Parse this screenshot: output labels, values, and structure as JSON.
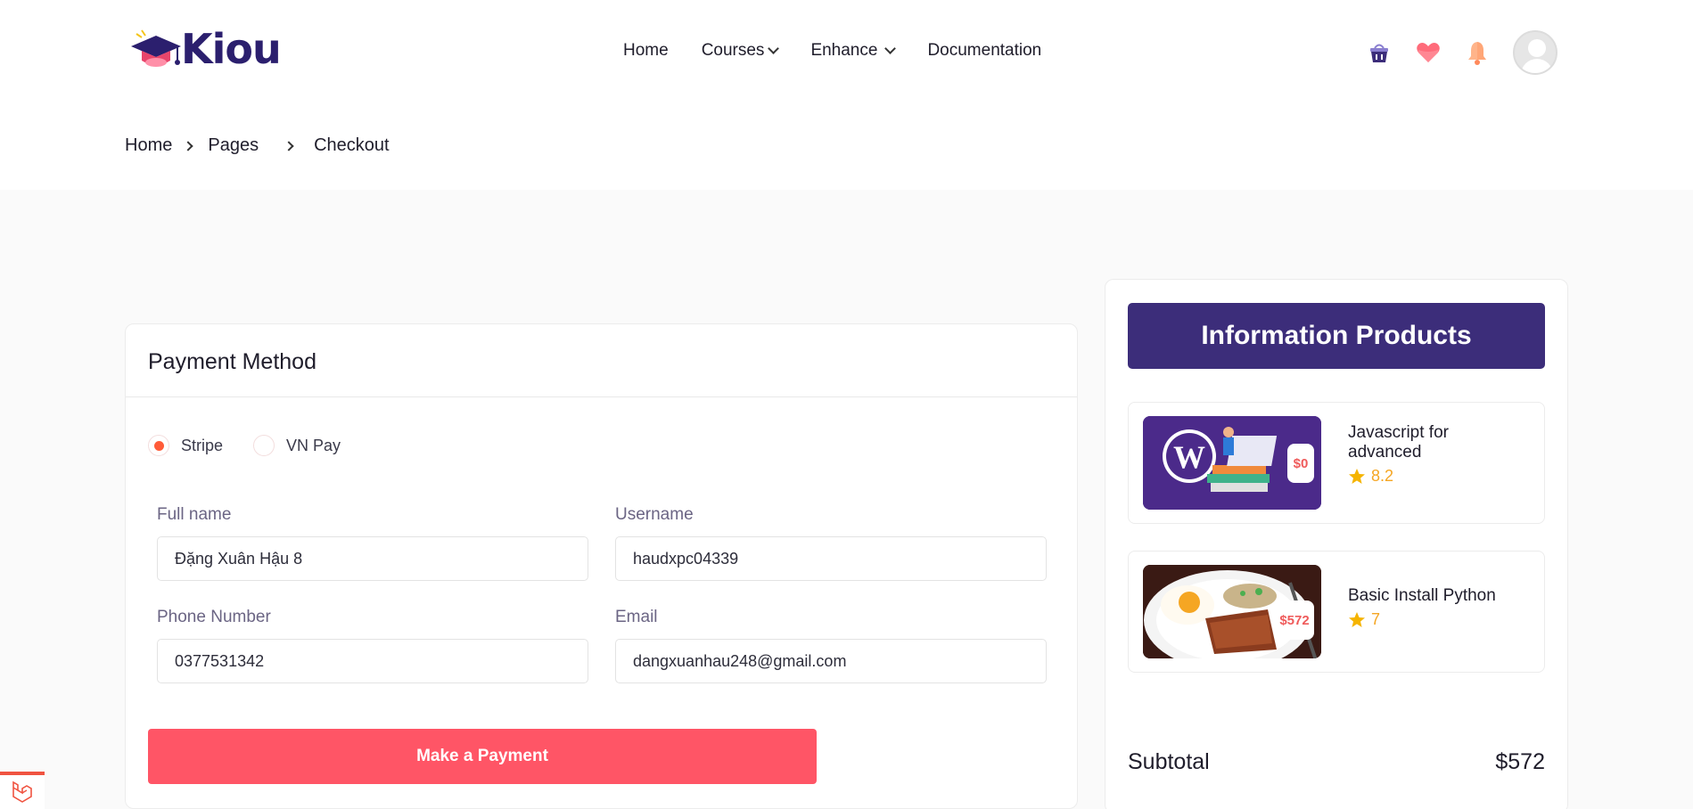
{
  "brand": {
    "name": "Kiou",
    "colors": {
      "primary": "#3c2d7a",
      "accent": "#ff5566",
      "radio": "#ff5c39",
      "star": "#f5a623"
    }
  },
  "nav": {
    "items": [
      {
        "label": "Home"
      },
      {
        "label": "Courses"
      },
      {
        "label": "Enhance"
      },
      {
        "label": "Documentation"
      }
    ]
  },
  "header_icons": [
    "basket-icon",
    "heart-icon",
    "bell-icon",
    "user-avatar"
  ],
  "breadcrumb": {
    "items": [
      "Home",
      "Pages",
      "Checkout"
    ]
  },
  "payment": {
    "title": "Payment Method",
    "methods": [
      {
        "label": "Stripe",
        "selected": true
      },
      {
        "label": "VN Pay",
        "selected": false
      }
    ],
    "fields": {
      "full_name": {
        "label": "Full name",
        "value": "Đặng Xuân Hậu 8"
      },
      "username": {
        "label": "Username",
        "value": "haudxpc04339"
      },
      "phone": {
        "label": "Phone Number",
        "value": "0377531342"
      },
      "email": {
        "label": "Email",
        "value": "dangxuanhau248@gmail.com"
      }
    },
    "submit_label": "Make a Payment"
  },
  "info": {
    "title": "Information Products",
    "products": [
      {
        "name": "Javascript for advanced",
        "price": "$0",
        "rating": "8.2"
      },
      {
        "name": "Basic Install Python",
        "price": "$572",
        "rating": "7"
      }
    ],
    "subtotal_label": "Subtotal",
    "subtotal_value": "$572"
  }
}
